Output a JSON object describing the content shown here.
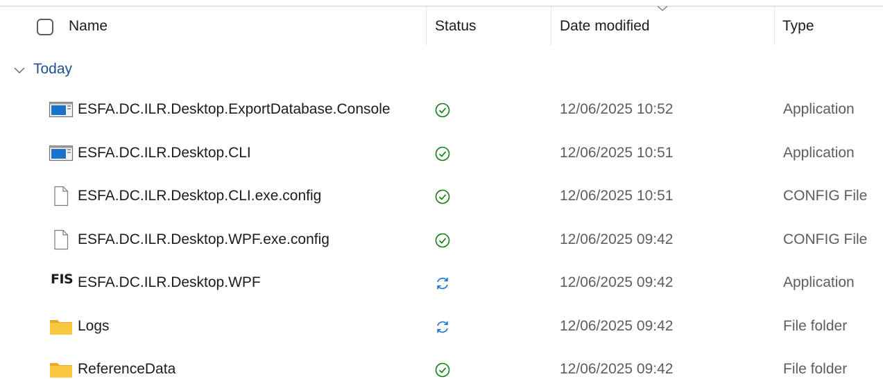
{
  "columns": {
    "name": "Name",
    "status": "Status",
    "date_modified": "Date modified",
    "type": "Type"
  },
  "sort": {
    "column": "date_modified",
    "direction": "descending",
    "icon": "chevron-down-icon"
  },
  "group": {
    "label": "Today",
    "expanded": true
  },
  "colors": {
    "accent": "#1f4f8e",
    "synced_green": "#0f7b0f",
    "syncing_blue": "#1a73c8",
    "folder_yellow": "#f8c73f"
  },
  "files": [
    {
      "name": "ESFA.DC.ILR.Desktop.ExportDatabase.Console",
      "icon": "application-icon",
      "status": "synced",
      "date": "12/06/2025 10:52",
      "type": "Application"
    },
    {
      "name": "ESFA.DC.ILR.Desktop.CLI",
      "icon": "application-icon",
      "status": "synced",
      "date": "12/06/2025 10:51",
      "type": "Application"
    },
    {
      "name": "ESFA.DC.ILR.Desktop.CLI.exe.config",
      "icon": "document-icon",
      "status": "synced",
      "date": "12/06/2025 10:51",
      "type": "CONFIG File"
    },
    {
      "name": "ESFA.DC.ILR.Desktop.WPF.exe.config",
      "icon": "document-icon",
      "status": "synced",
      "date": "12/06/2025 09:42",
      "type": "CONFIG File"
    },
    {
      "name": "ESFA.DC.ILR.Desktop.WPF",
      "icon": "fis-app-icon",
      "icon_text": "FIS",
      "status": "syncing",
      "date": "12/06/2025 09:42",
      "type": "Application"
    },
    {
      "name": "Logs",
      "icon": "folder-icon",
      "status": "syncing",
      "date": "12/06/2025 09:42",
      "type": "File folder"
    },
    {
      "name": "ReferenceData",
      "icon": "folder-icon",
      "status": "synced",
      "date": "12/06/2025 09:42",
      "type": "File folder"
    }
  ]
}
